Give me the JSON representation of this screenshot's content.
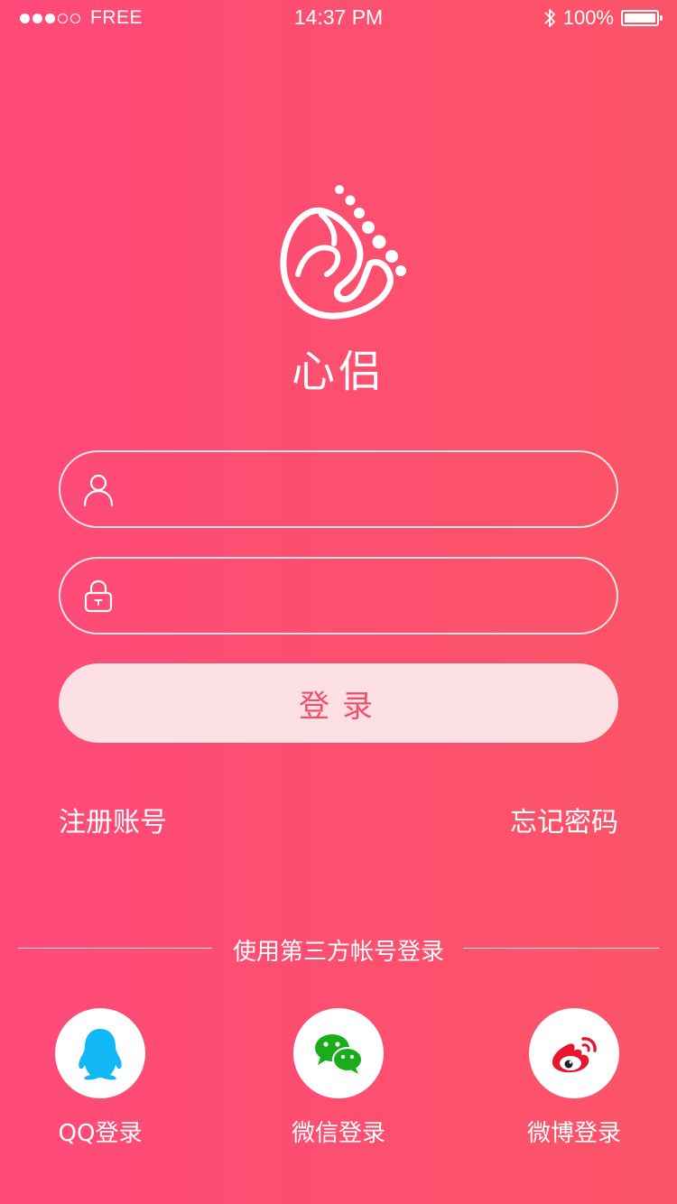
{
  "status_bar": {
    "carrier": "FREE",
    "time": "14:37 PM",
    "battery": "100%",
    "signal_bars_filled": 3,
    "signal_bars_total": 5
  },
  "app": {
    "name": "心侣"
  },
  "form": {
    "username_value": "",
    "password_value": "",
    "login_label": "登录"
  },
  "links": {
    "register": "注册账号",
    "forgot": "忘记密码"
  },
  "third_party": {
    "title": "使用第三方帐号登录",
    "items": [
      {
        "label": "QQ登录",
        "icon": "qq-icon"
      },
      {
        "label": "微信登录",
        "icon": "wechat-icon"
      },
      {
        "label": "微博登录",
        "icon": "weibo-icon"
      }
    ]
  },
  "colors": {
    "gradient_start": "#ff4a79",
    "gradient_end": "#fb5467",
    "login_button_bg": "#fde0e3",
    "login_button_text": "#f0506e",
    "qq_blue": "#12b7f5",
    "wechat_green": "#1aad19",
    "weibo_red": "#e6162d"
  }
}
